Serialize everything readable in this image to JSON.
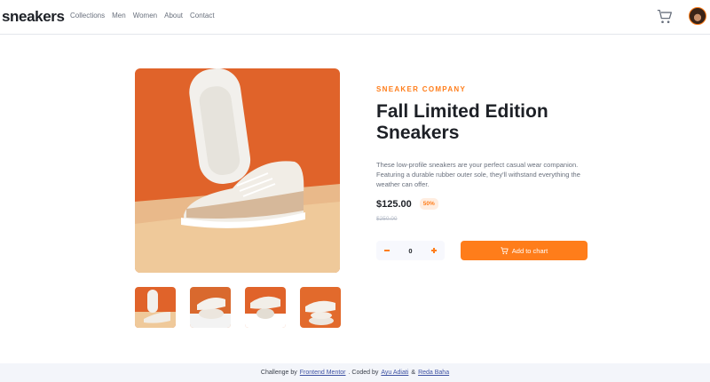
{
  "header": {
    "logo": "sneakers",
    "nav": [
      "Collections",
      "Men",
      "Women",
      "About",
      "Contact"
    ]
  },
  "product": {
    "company": "SNEAKER COMPANY",
    "title": "Fall Limited Edition Sneakers",
    "description": "These low-profile sneakers are your perfect casual wear companion. Featuring a durable rubber outer sole, they'll withstand everything the weather can offer.",
    "price": "$125.00",
    "discount": "50%",
    "old_price": "$250.00",
    "quantity": "0",
    "add_label": "Add to chart"
  },
  "footer": {
    "prefix": "Challenge by",
    "fm": "Frontend Mentor",
    "coded": ". Coded by",
    "author1": "Ayu Adiati",
    "amp": "&",
    "author2": "Reda Baha"
  },
  "colors": {
    "accent": "#ff7d1a",
    "accent_light": "#ffede0",
    "dark": "#1d2026",
    "muted": "#69707d"
  }
}
